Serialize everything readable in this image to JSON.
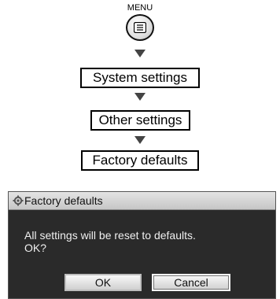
{
  "menu": {
    "label": "MENU",
    "icon": "menu-button-icon"
  },
  "steps": [
    {
      "label": "System settings"
    },
    {
      "label": "Other settings"
    },
    {
      "label": "Factory defaults"
    }
  ],
  "dialog": {
    "title": "Factory defaults",
    "title_icon": "settings-icon",
    "message": "All settings will be reset to defaults.\nOK?",
    "buttons": {
      "ok": "OK",
      "cancel": "Cancel"
    },
    "colors": {
      "background": "#2a2a2a",
      "titlebar": "#d6d6d6"
    }
  }
}
